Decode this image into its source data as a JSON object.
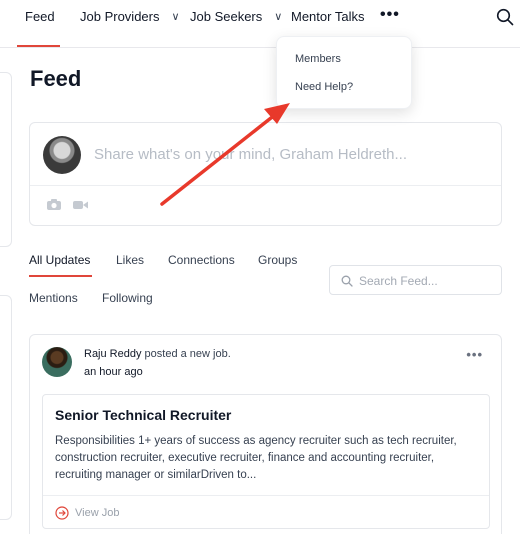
{
  "nav": {
    "feed": "Feed",
    "job_providers": "Job Providers",
    "job_seekers": "Job Seekers",
    "mentor_talks": "Mentor Talks",
    "more": "•••",
    "chevron": "∨"
  },
  "dropdown": {
    "members": "Members",
    "need_help": "Need Help?"
  },
  "page": {
    "title": "Feed"
  },
  "composer": {
    "placeholder": "Share what's on your mind, Graham Heldreth..."
  },
  "tabs": {
    "all_updates": "All Updates",
    "likes": "Likes",
    "connections": "Connections",
    "groups": "Groups",
    "mentions": "Mentions",
    "following": "Following"
  },
  "search": {
    "placeholder": "Search Feed..."
  },
  "post": {
    "author": "Raju Reddy",
    "action": " posted a new job.",
    "time": "an hour ago",
    "menu": "•••",
    "job": {
      "title": "Senior Technical Recruiter",
      "description": "Responsibilities 1+ years of success as agency recruiter such as tech recruiter, construction recruiter, executive recruiter, finance and accounting recruiter, recruiting manager or similarDriven to...",
      "view_label": "View Job"
    }
  },
  "colors": {
    "accent": "#e0463a",
    "annotation_arrow": "#e8392b"
  }
}
